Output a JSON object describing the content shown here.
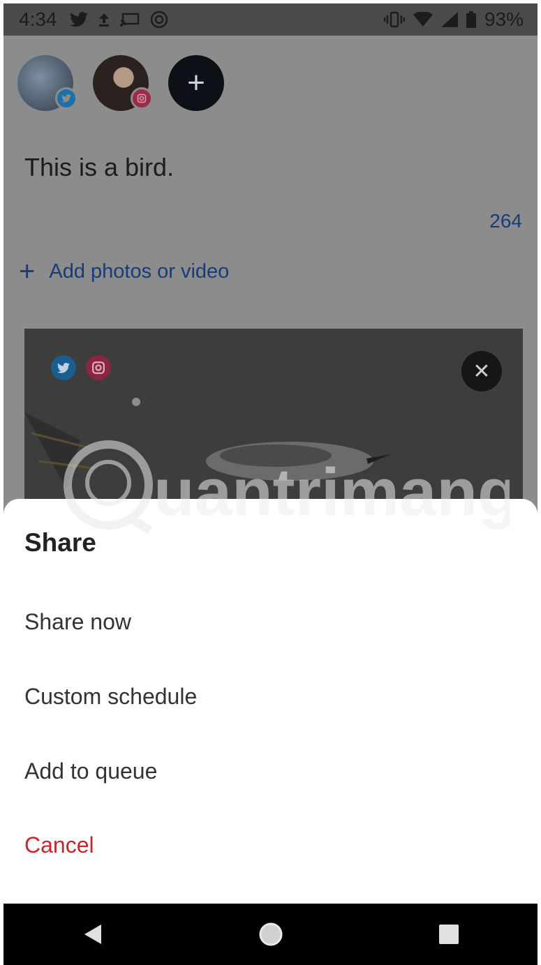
{
  "status_bar": {
    "time": "4:34",
    "battery": "93%",
    "left_icons": [
      "twitter-icon",
      "upload-icon",
      "cast-icon",
      "data-saver-icon"
    ],
    "right_icons": [
      "vibrate-icon",
      "wifi-icon",
      "signal-icon",
      "battery-icon"
    ]
  },
  "composer": {
    "accounts": [
      {
        "name": "twitter-account-avatar",
        "network": "twitter"
      },
      {
        "name": "instagram-account-avatar",
        "network": "instagram"
      }
    ],
    "add_account_icon": "plus-icon",
    "text": "This is a bird.",
    "char_count": "264",
    "add_media_label": "Add photos or video",
    "media": {
      "networks": [
        "twitter",
        "instagram"
      ],
      "remove_icon": "close-icon"
    }
  },
  "share_sheet": {
    "title": "Share",
    "options": [
      "Share now",
      "Custom schedule",
      "Add to queue",
      "Cancel"
    ]
  },
  "watermark": {
    "text": "uantrimang"
  },
  "nav_bar": {
    "icons": [
      "back-icon",
      "home-icon",
      "recents-icon"
    ]
  },
  "colors": {
    "accent_link": "#183c7a",
    "cancel": "#c8262f",
    "twitter": "#1e6ea8",
    "instagram": "#9c2b4a"
  }
}
